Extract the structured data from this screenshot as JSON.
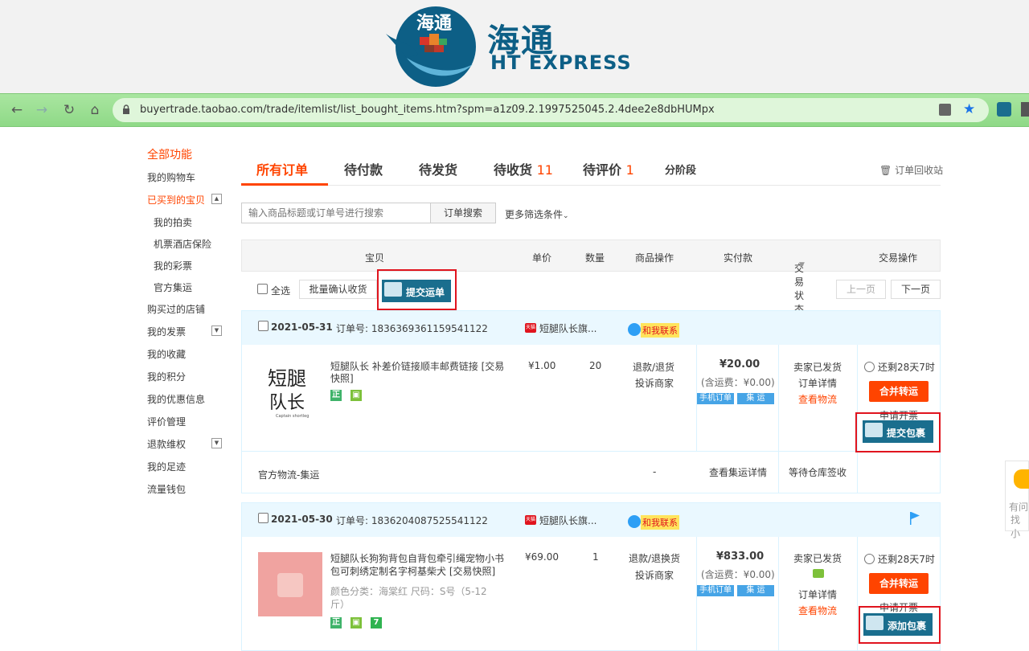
{
  "banner": {
    "brand_cn": "海通",
    "brand_en": "HT EXPRESS",
    "logo_text": "海通"
  },
  "browser": {
    "url": "buyertrade.taobao.com/trade/itemlist/list_bought_items.htm?spm=a1z09.2.1997525045.2.4dee2e8dbHUMpx"
  },
  "sidebar": {
    "title": "全部功能",
    "items": [
      "我的购物车",
      "已买到的宝贝",
      "我的拍卖",
      "机票酒店保险",
      "我的彩票",
      "官方集运",
      "购买过的店铺",
      "我的发票",
      "我的收藏",
      "我的积分",
      "我的优惠信息",
      "评价管理",
      "退款维权",
      "我的足迹",
      "流量钱包"
    ]
  },
  "tabs": [
    {
      "label": "所有订单"
    },
    {
      "label": "待付款"
    },
    {
      "label": "待发货"
    },
    {
      "label": "待收货",
      "count": "11"
    },
    {
      "label": "待评价",
      "count": "1"
    },
    {
      "label": "分阶段"
    }
  ],
  "recycle_bin": "订单回收站",
  "search": {
    "placeholder": "输入商品标题或订单号进行搜索",
    "button": "订单搜索",
    "more_filters": "更多筛选条件"
  },
  "table_headers": [
    "宝贝",
    "单价",
    "数量",
    "商品操作",
    "实付款",
    "交易状态",
    "交易操作"
  ],
  "toolbar": {
    "select_all": "全选",
    "batch_confirm": "批量确认收货",
    "submit_waybill": "提交运单",
    "prev_page": "上一页",
    "next_page": "下一页"
  },
  "orders": [
    {
      "date": "2021-05-31",
      "order_no_label": "订单号:",
      "order_no": "1836369361159541122",
      "shop": "短腿队长旗...",
      "contact": "和我联系",
      "thumb_text_1": "短腿",
      "thumb_text_2": "队长",
      "thumb_sub": "Captain shortleg",
      "title": "短腿队长 补差价链接顺丰邮费链接 [交易快照]",
      "price": "¥1.00",
      "qty": "20",
      "ops": [
        "退款/退货",
        "投诉商家"
      ],
      "total": "¥20.00",
      "shipping": "(含运费：¥0.00)",
      "badges": [
        "手机订单",
        "集 运"
      ],
      "status": [
        "卖家已发货",
        "订单详情",
        "查看物流"
      ],
      "timer": "还剩28天7时",
      "merge_btn": "合并转运",
      "invoice": "申请开票",
      "teal_btn": "提交包裹",
      "sub_row": {
        "label": "官方物流-集运",
        "dash": "-",
        "detail": "查看集运详情",
        "status": "等待仓库签收"
      }
    },
    {
      "date": "2021-05-30",
      "order_no_label": "订单号:",
      "order_no": "1836204087525541122",
      "shop": "短腿队长旗...",
      "contact": "和我联系",
      "title": "短腿队长狗狗背包自背包牵引绳宠物小书包可刺绣定制名字柯基柴犬 [交易快照]",
      "variant": "颜色分类：海棠红  尺码：S号（5-12斤）",
      "price": "¥69.00",
      "qty": "1",
      "ops": [
        "退款/退换货",
        "投诉商家"
      ],
      "total": "¥833.00",
      "shipping": "(含运费：¥0.00)",
      "badges": [
        "手机订单",
        "集 运"
      ],
      "status": [
        "卖家已发货",
        "订单详情",
        "查看物流"
      ],
      "timer": "还剩28天7时",
      "merge_btn": "合并转运",
      "invoice": "申请开票",
      "teal_btn": "添加包裹"
    }
  ],
  "side_float": {
    "line1": "有问",
    "line2": "找小"
  },
  "colors": {
    "accent": "#ff4400",
    "teal": "#1a6e8e",
    "highlight_box": "#e0141e",
    "order_header_bg": "#eaf8ff"
  }
}
